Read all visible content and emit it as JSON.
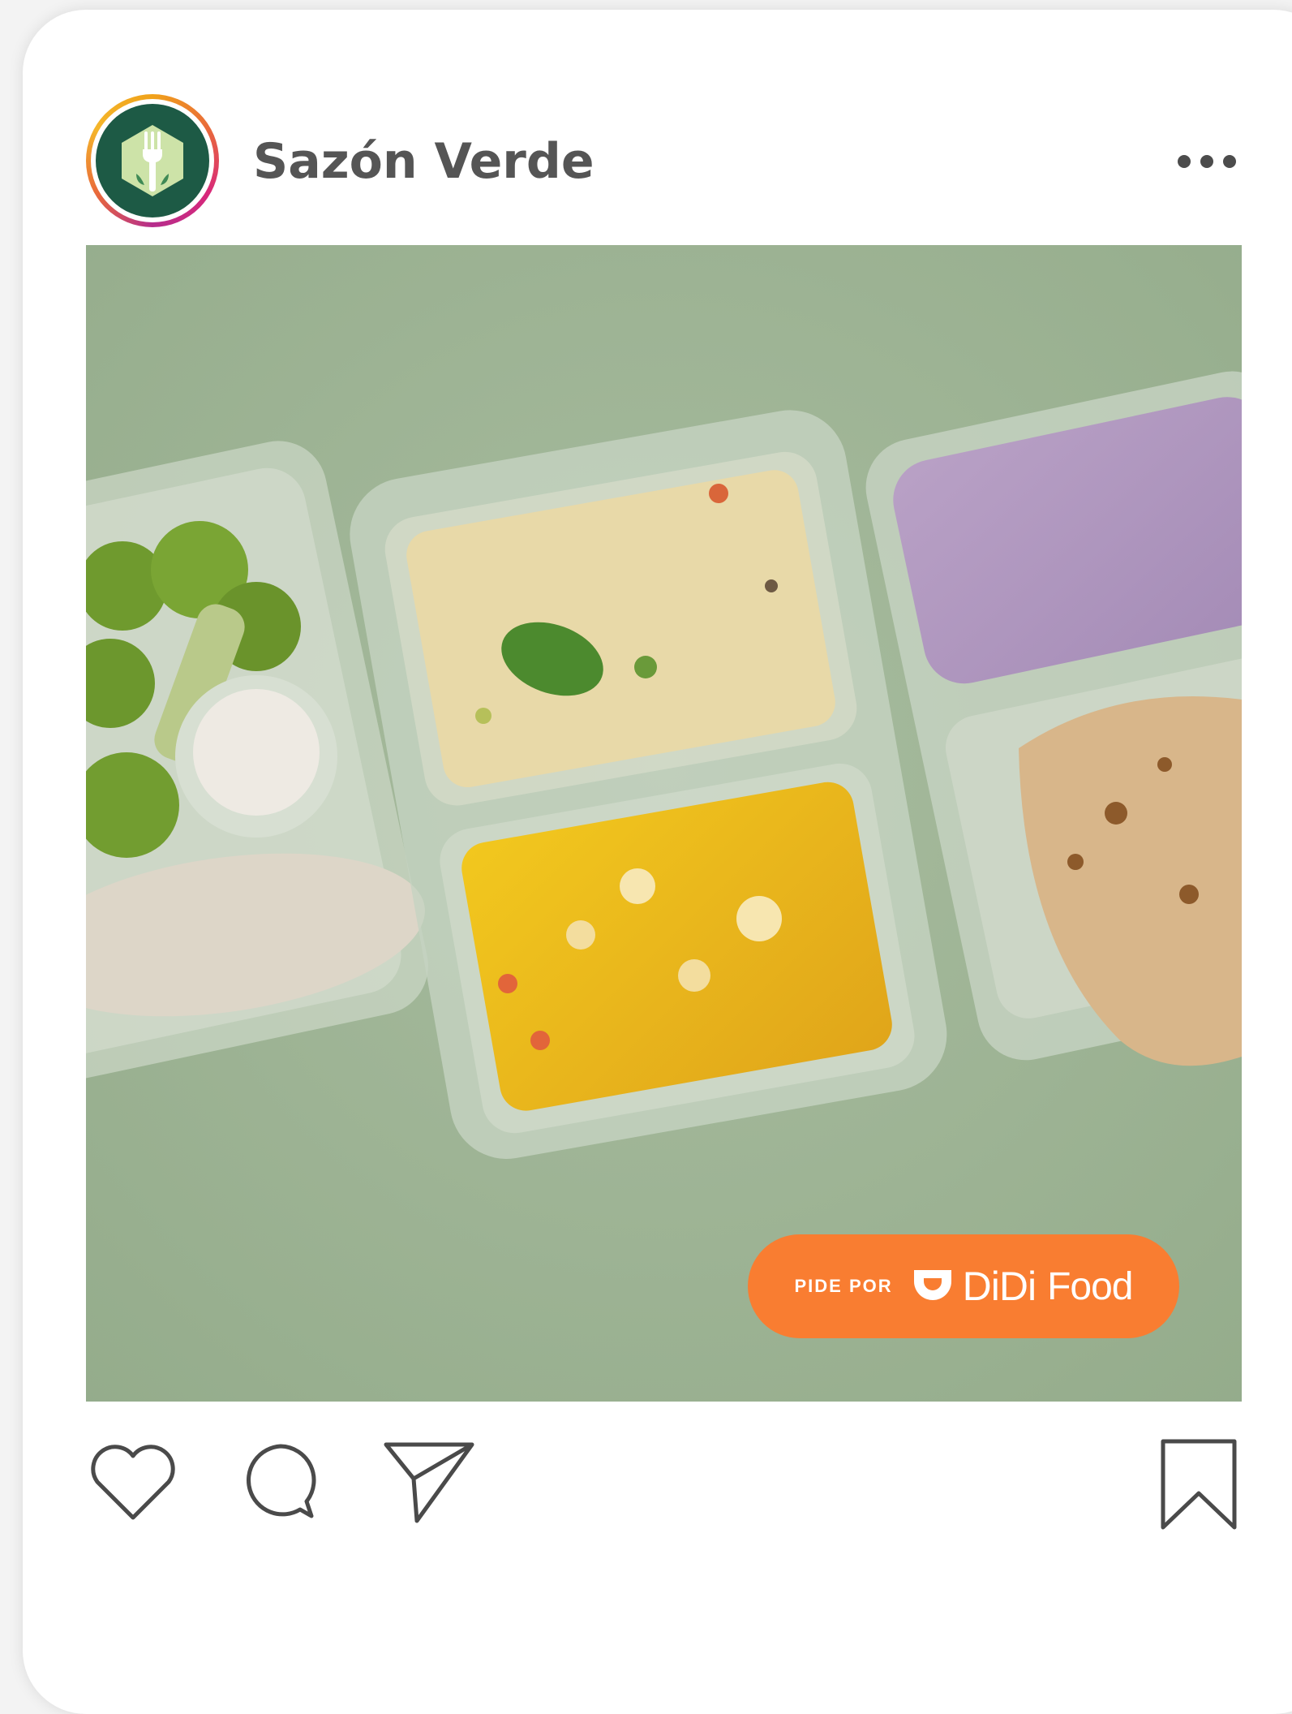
{
  "post": {
    "username": "Sazón Verde",
    "more_icon": "more-horizontal-icon",
    "avatar_icon": "fork-leaf-logo-icon"
  },
  "cta": {
    "prefix": "PIDE POR",
    "brand_part1": "DiDi",
    "brand_part2": "Food",
    "brand_icon": "didi-logo-icon",
    "color": "#f97d31"
  },
  "actions": {
    "like_icon": "heart-icon",
    "comment_icon": "comment-icon",
    "share_icon": "send-icon",
    "save_icon": "bookmark-icon"
  },
  "colors": {
    "background": "#a3b89a",
    "text": "#555555"
  }
}
